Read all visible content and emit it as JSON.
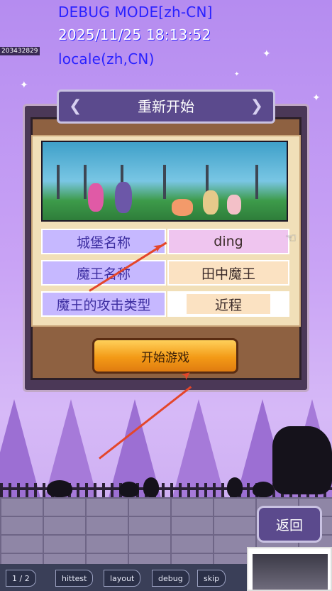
{
  "debug": {
    "mode_line": "DEBUG MODE[zh-CN]",
    "datetime_line": "2025/11/25 18:13:52",
    "locale_line": "locale(zh,CN)",
    "build_id": "203432829"
  },
  "dialog": {
    "title": "重新开始",
    "rows": [
      {
        "label": "城堡名称",
        "value": "ding"
      },
      {
        "label": "魔王名称",
        "value": "田中魔王"
      },
      {
        "label": "魔王的攻击类型",
        "value": "近程"
      }
    ],
    "start_label": "开始游戏"
  },
  "back_label": "返回",
  "toolbar": {
    "page": "1 / 2",
    "items": [
      "hittest",
      "layout",
      "debug",
      "skip"
    ]
  }
}
